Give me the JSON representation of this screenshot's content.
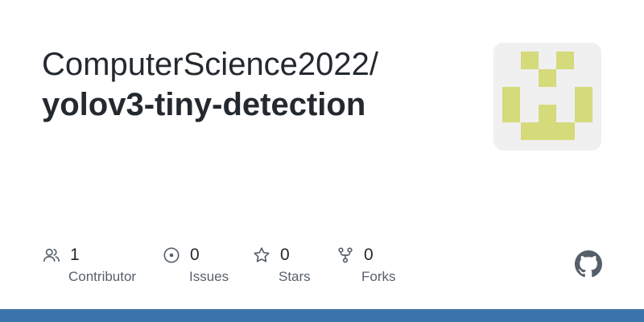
{
  "repo": {
    "owner": "ComputerScience2022/",
    "name": "yolov3-tiny-detection"
  },
  "stats": [
    {
      "icon": "contributors-icon",
      "count": "1",
      "label": "Contributor"
    },
    {
      "icon": "issues-icon",
      "count": "0",
      "label": "Issues"
    },
    {
      "icon": "star-icon",
      "count": "0",
      "label": "Stars"
    },
    {
      "icon": "fork-icon",
      "count": "0",
      "label": "Forks"
    }
  ],
  "colors": {
    "identicon": "#d5da7b",
    "identicon_bg": "#f0f0f0",
    "bottom_bar": "#3b74ab",
    "icon_gray": "#57606a"
  },
  "icons": {
    "avatar": "identicon",
    "brand": "github-mark-icon"
  }
}
